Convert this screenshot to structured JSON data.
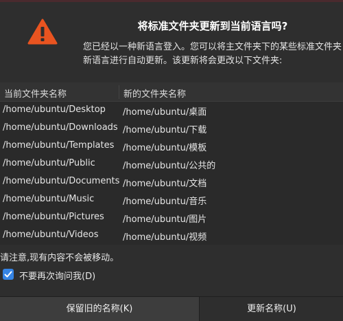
{
  "dialog": {
    "title": "将标准文件夹更新到当前语言吗?",
    "description_line1": "您已经以一种新语言登入。您可以将主文件夹下的某些标准文件夹",
    "description_line2": "新语言进行自动更新。该更新将会更改以下文件夹:",
    "icon": "warning-triangle-icon",
    "icon_color": "#e95420"
  },
  "table": {
    "headers": [
      "当前文件夹名称",
      "新的文件夹名称"
    ],
    "rows": [
      [
        "/home/ubuntu/Desktop",
        "/home/ubuntu/桌面"
      ],
      [
        "/home/ubuntu/Downloads",
        "/home/ubuntu/下载"
      ],
      [
        "/home/ubuntu/Templates",
        "/home/ubuntu/模板"
      ],
      [
        "/home/ubuntu/Public",
        "/home/ubuntu/公共的"
      ],
      [
        "/home/ubuntu/Documents",
        "/home/ubuntu/文档"
      ],
      [
        "/home/ubuntu/Music",
        "/home/ubuntu/音乐"
      ],
      [
        "/home/ubuntu/Pictures",
        "/home/ubuntu/图片"
      ],
      [
        "/home/ubuntu/Videos",
        "/home/ubuntu/视频"
      ]
    ]
  },
  "note": "请注意,现有内容不会被移动。",
  "dont_ask": {
    "label": "不要再次询问我(D)",
    "checked": true,
    "check_color": "#3584e4"
  },
  "buttons": {
    "keep_label": "保留旧的名称(K)",
    "update_label": "更新名称(U)"
  }
}
